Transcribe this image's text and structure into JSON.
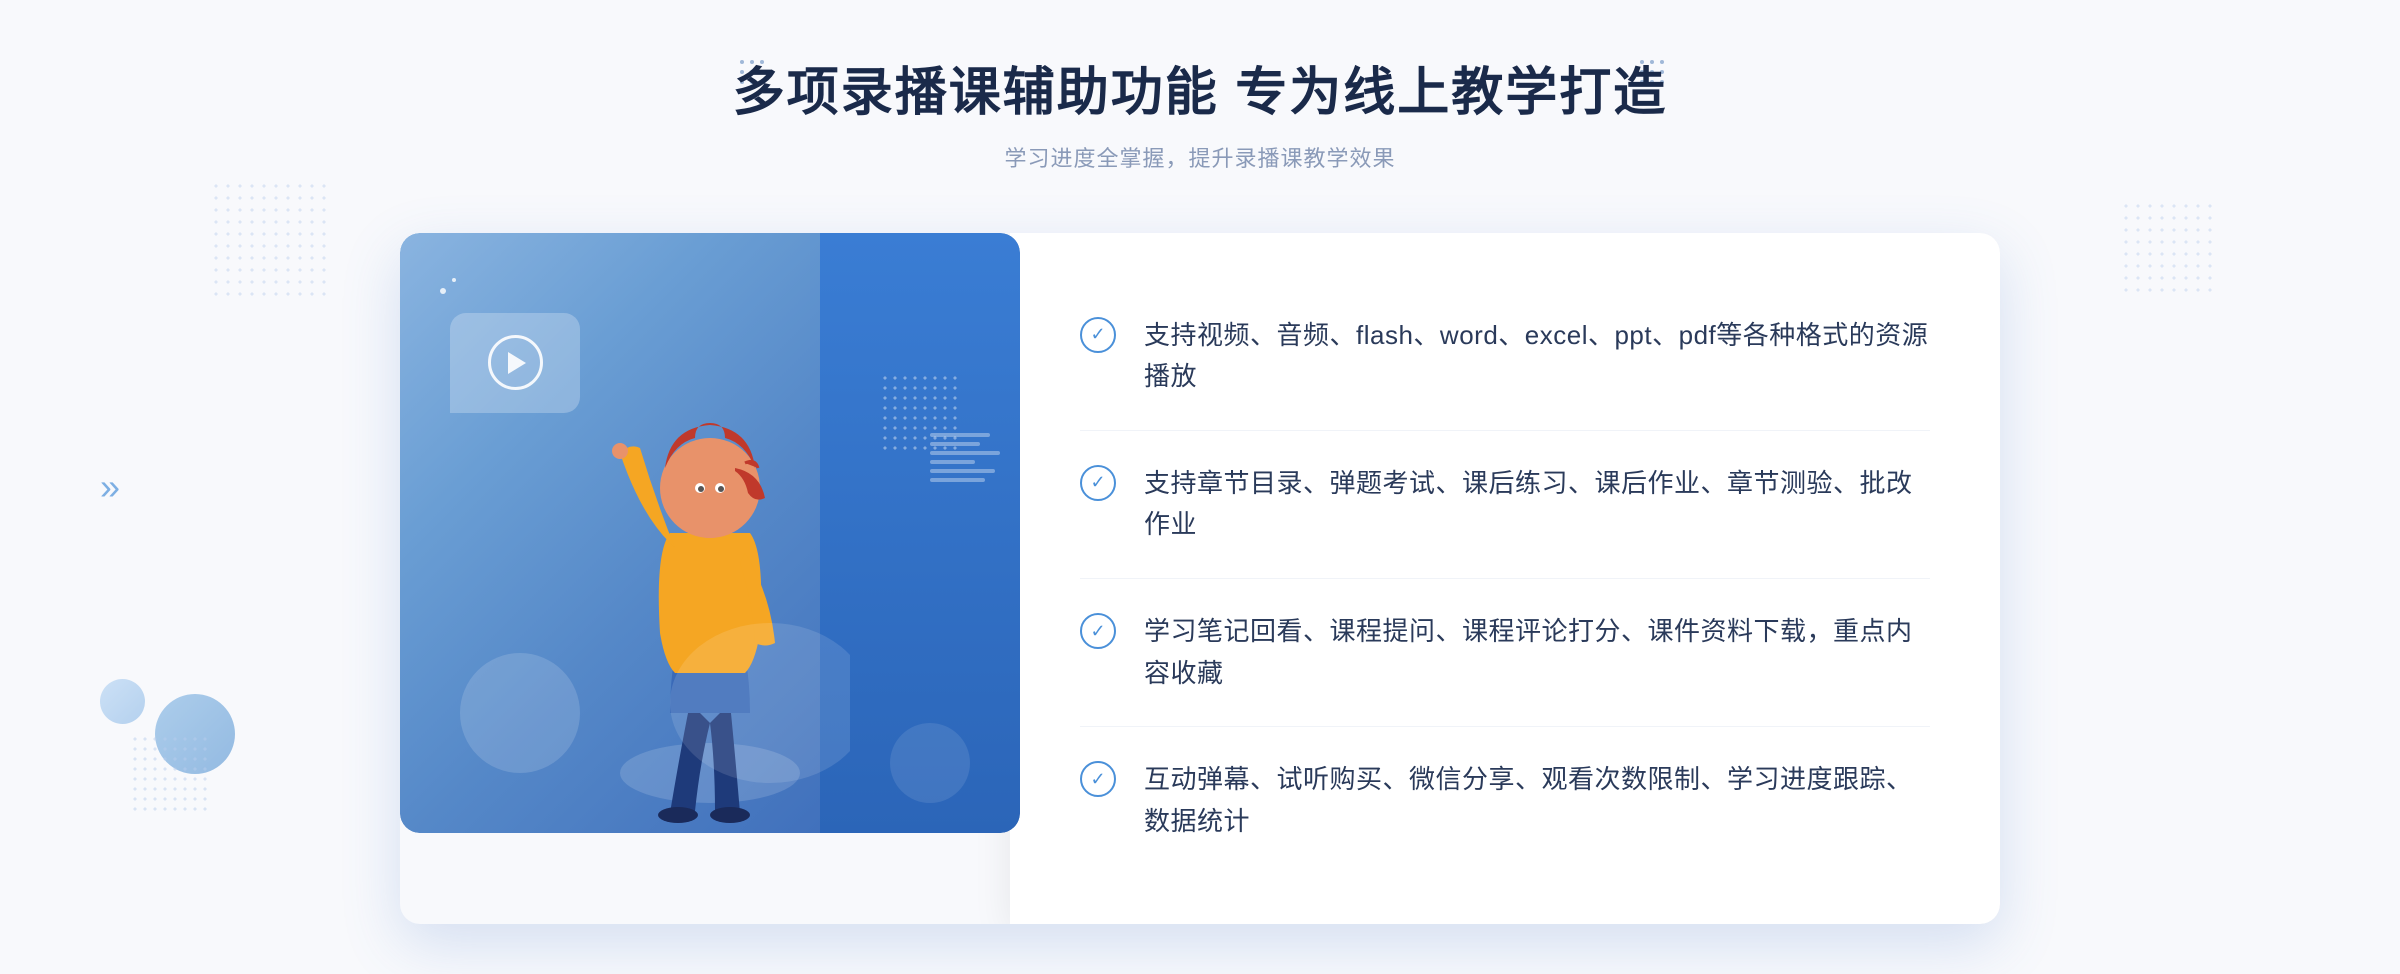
{
  "page": {
    "background_color": "#f0f4fb"
  },
  "header": {
    "main_title": "多项录播课辅助功能 专为线上教学打造",
    "sub_title": "学习进度全掌握，提升录播课教学效果"
  },
  "features": [
    {
      "id": 1,
      "text": "支持视频、音频、flash、word、excel、ppt、pdf等各种格式的资源播放"
    },
    {
      "id": 2,
      "text": "支持章节目录、弹题考试、课后练习、课后作业、章节测验、批改作业"
    },
    {
      "id": 3,
      "text": "学习笔记回看、课程提问、课程评论打分、课件资料下载，重点内容收藏"
    },
    {
      "id": 4,
      "text": "互动弹幕、试听购买、微信分享、观看次数限制、学习进度跟踪、数据统计"
    }
  ],
  "decoration": {
    "chevron_symbol": "»",
    "play_button_label": "play"
  }
}
